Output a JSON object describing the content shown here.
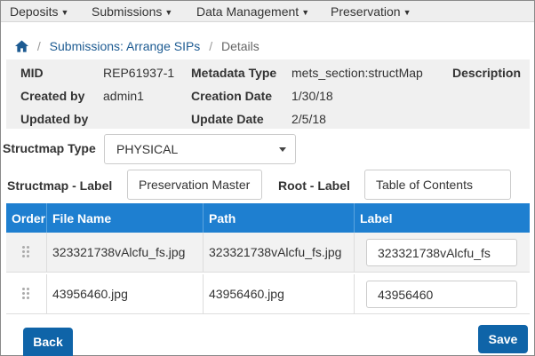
{
  "nav": {
    "items": [
      {
        "label": "Deposits"
      },
      {
        "label": "Submissions"
      },
      {
        "label": "Data Management"
      },
      {
        "label": "Preservation"
      }
    ]
  },
  "breadcrumb": {
    "link": "Submissions: Arrange SIPs",
    "current": "Details"
  },
  "info": {
    "mid_label": "MID",
    "mid_value": "REP61937-1",
    "metadata_type_label": "Metadata Type",
    "metadata_type_value": "mets_section:structMap",
    "description_label": "Description",
    "created_by_label": "Created by",
    "created_by_value": "admin1",
    "creation_date_label": "Creation Date",
    "creation_date_value": "1/30/18",
    "updated_by_label": "Updated by",
    "update_date_label": "Update Date",
    "update_date_value": "2/5/18"
  },
  "form": {
    "structmap_type_label": "Structmap Type",
    "structmap_type_value": "PHYSICAL",
    "structmap_label_label": "Structmap - Label",
    "structmap_label_value": "Preservation Master",
    "root_label_label": "Root - Label",
    "root_label_value": "Table of Contents"
  },
  "table": {
    "headers": {
      "order": "Order",
      "file_name": "File Name",
      "path": "Path",
      "label": "Label"
    },
    "rows": [
      {
        "file_name": "323321738vAlcfu_fs.jpg",
        "path": "323321738vAlcfu_fs.jpg",
        "label": "323321738vAlcfu_fs"
      },
      {
        "file_name": "43956460.jpg",
        "path": "43956460.jpg",
        "label": "43956460"
      }
    ]
  },
  "buttons": {
    "back": "Back",
    "save": "Save"
  },
  "colors": {
    "header_blue": "#1e7fd0",
    "button_blue": "#0f64a8",
    "link_blue": "#1d5b92"
  }
}
